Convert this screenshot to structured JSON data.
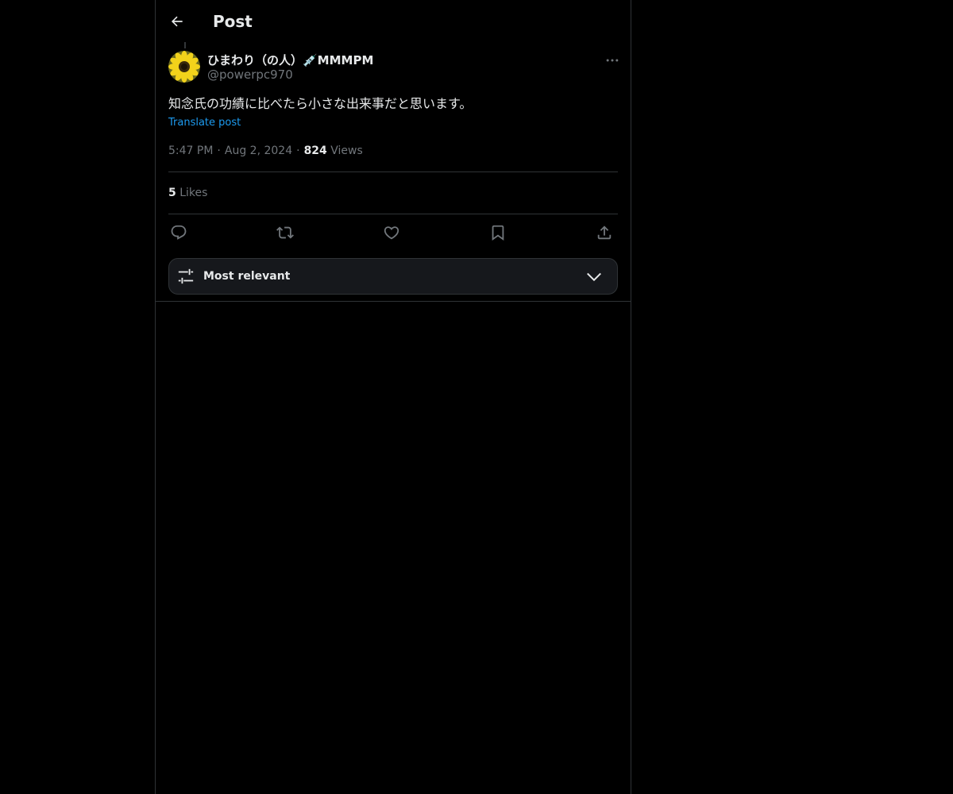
{
  "header": {
    "title": "Post",
    "back_icon": "arrow-left-icon"
  },
  "author": {
    "display_name": "ひまわり（の人）💉MMMPM",
    "handle": "@powerpc970",
    "avatar_icon": "sunflower-avatar"
  },
  "post": {
    "text": "知念氏の功績に比べたら小さな出来事だと思います。",
    "translate_label": "Translate post",
    "time": "5:47 PM",
    "separator": "·",
    "date": "Aug 2, 2024",
    "views_count": "824",
    "views_label": "Views"
  },
  "engagement": {
    "likes_count": "5",
    "likes_label": "Likes"
  },
  "actions": [
    "reply-icon",
    "repost-icon",
    "like-icon",
    "bookmark-icon",
    "share-icon"
  ],
  "sort": {
    "label": "Most relevant",
    "icon": "sliders-icon",
    "chevron": "chevron-down-icon"
  },
  "colors": {
    "background": "#000000",
    "text_primary": "#e7e9ea",
    "text_secondary": "#71767b",
    "accent": "#1d9bf0",
    "border": "#2f3336"
  }
}
